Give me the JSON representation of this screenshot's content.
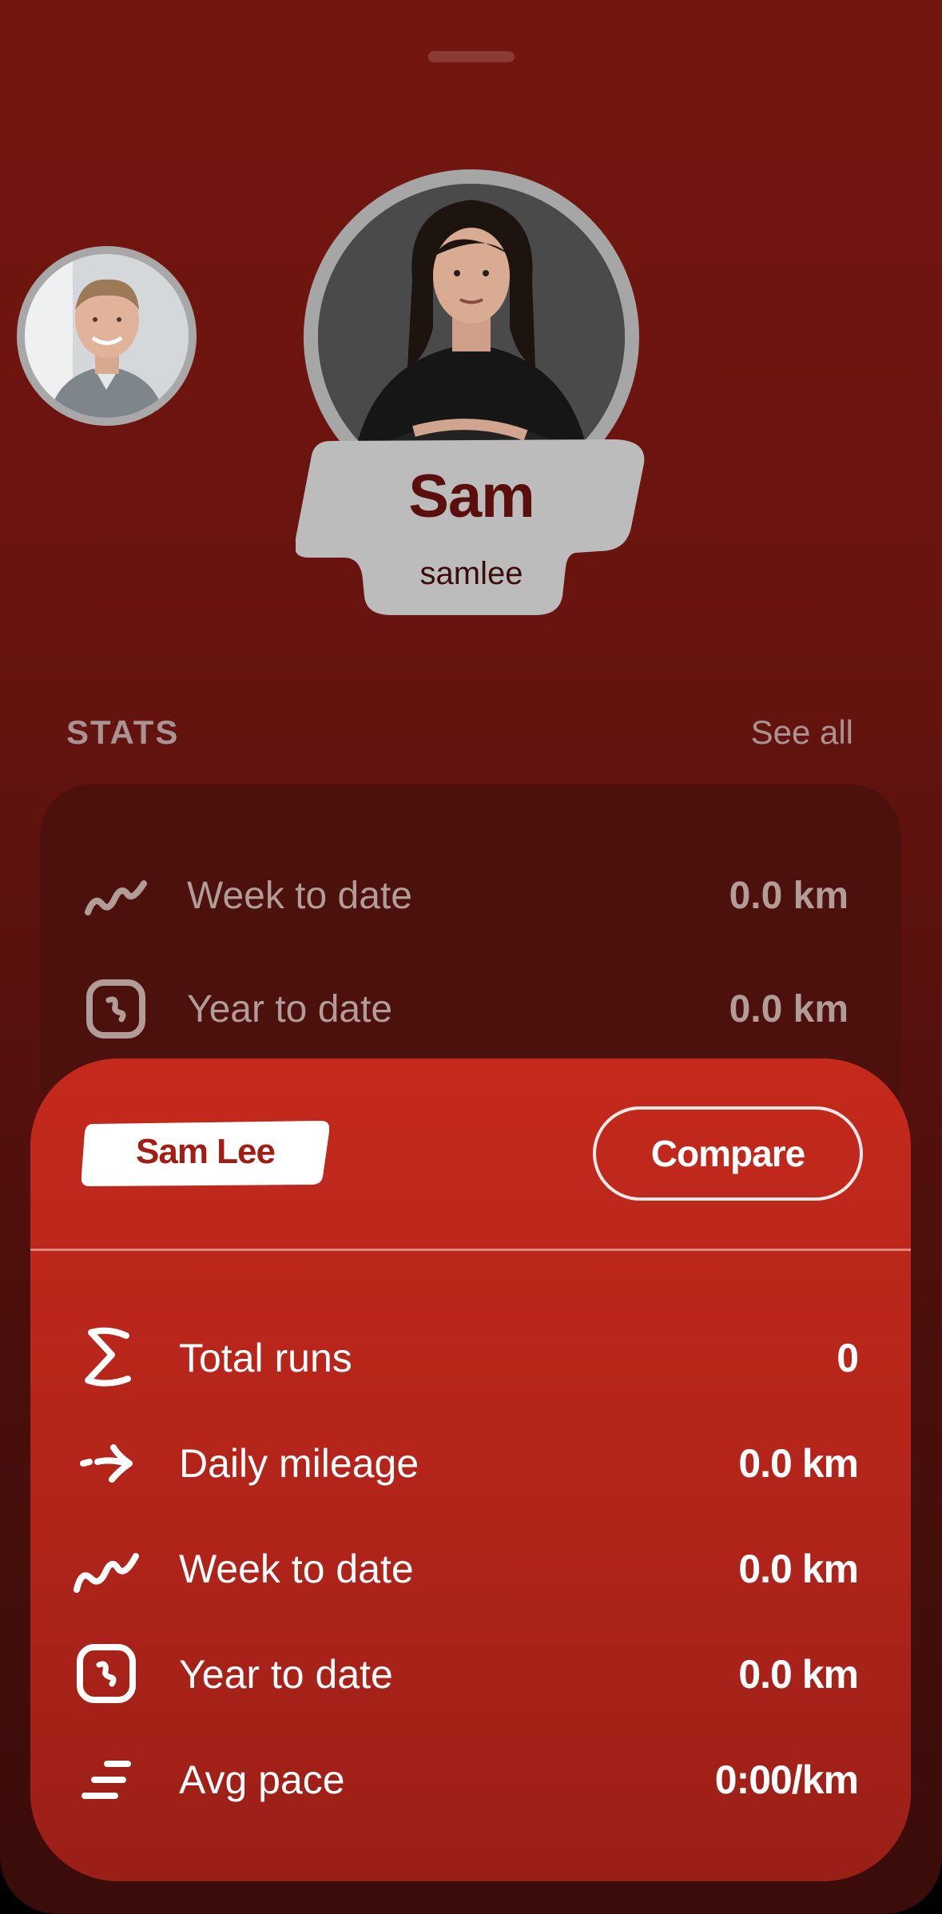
{
  "profile": {
    "name": "Sam",
    "username": "samlee"
  },
  "stats_header": {
    "title": "STATS",
    "see_all": "See all"
  },
  "stats_preview": [
    {
      "icon": "trend-squiggle-icon",
      "label": "Week to date",
      "value": "0.0 km"
    },
    {
      "icon": "calendar-clock-icon",
      "label": "Year to date",
      "value": "0.0 km"
    }
  ],
  "card": {
    "user_tag": "Sam Lee",
    "compare_label": "Compare",
    "rows": [
      {
        "icon": "sigma-icon",
        "label": "Total runs",
        "value": "0"
      },
      {
        "icon": "arrow-right-icon",
        "label": "Daily mileage",
        "value": "0.0 km"
      },
      {
        "icon": "trend-squiggle-icon",
        "label": "Week to date",
        "value": "0.0 km"
      },
      {
        "icon": "calendar-clock-icon",
        "label": "Year to date",
        "value": "0.0 km"
      },
      {
        "icon": "pace-lines-icon",
        "label": "Avg pace",
        "value": "0:00/km"
      }
    ]
  },
  "colors": {
    "background_top": "#741610",
    "card_red": "#c4291c",
    "name_card_gray": "#bcbcbc",
    "text_muted": "#b29c98"
  }
}
